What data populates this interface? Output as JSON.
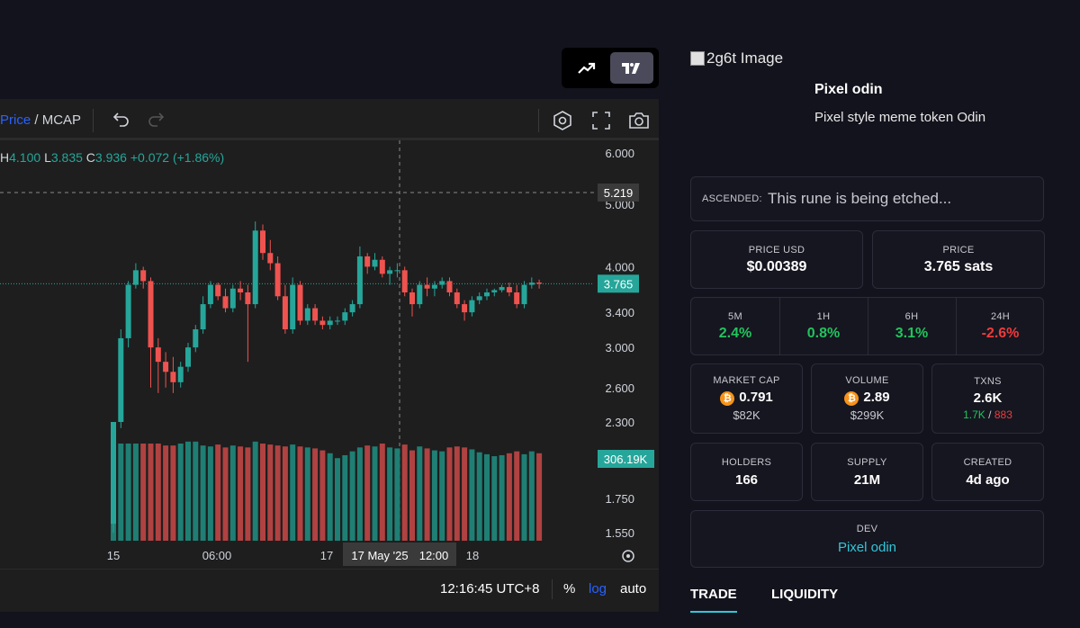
{
  "chart_toolbar": {
    "price_label": "Price",
    "separator": " / ",
    "mcap_label": "MCAP"
  },
  "ohlc": {
    "h_key": "H",
    "h_val": "4.100",
    "l_key": "L",
    "l_val": "3.835",
    "c_key": "C",
    "c_val": "3.936",
    "change": "+0.072 (+1.86%)"
  },
  "chart_data": {
    "type": "candlestick",
    "price_ticks": [
      "6.000",
      "5.000",
      "4.000",
      "3.400",
      "3.000",
      "2.600",
      "2.300",
      "1.750",
      "1.550"
    ],
    "price_tick_values": [
      6.0,
      5.0,
      4.0,
      3.4,
      3.0,
      2.6,
      2.3,
      1.75,
      1.55
    ],
    "x_ticks": [
      "15",
      "06:00",
      "17",
      "12:00",
      "18"
    ],
    "crosshair_date_label": "17 May '25",
    "crosshair_time_label": "12:00",
    "crosshair_price": "5.219",
    "last_price": "3.765",
    "last_volume": "306.19K",
    "ohlc": [
      [
        1.6,
        2.3,
        1.55,
        2.3
      ],
      [
        2.3,
        3.2,
        2.25,
        3.1
      ],
      [
        3.1,
        3.8,
        3.0,
        3.75
      ],
      [
        3.75,
        4.05,
        3.7,
        3.95
      ],
      [
        3.95,
        4.0,
        3.7,
        3.8
      ],
      [
        3.8,
        3.85,
        2.6,
        3.0
      ],
      [
        3.0,
        3.1,
        2.55,
        2.85
      ],
      [
        2.85,
        2.95,
        2.6,
        2.75
      ],
      [
        2.75,
        2.9,
        2.55,
        2.65
      ],
      [
        2.65,
        2.85,
        2.6,
        2.8
      ],
      [
        2.8,
        3.05,
        2.75,
        3.0
      ],
      [
        3.0,
        3.25,
        2.95,
        3.2
      ],
      [
        3.2,
        3.6,
        3.15,
        3.5
      ],
      [
        3.5,
        3.8,
        3.45,
        3.75
      ],
      [
        3.75,
        3.78,
        3.55,
        3.6
      ],
      [
        3.6,
        3.7,
        3.4,
        3.45
      ],
      [
        3.45,
        3.75,
        3.4,
        3.7
      ],
      [
        3.7,
        3.8,
        3.55,
        3.65
      ],
      [
        3.65,
        3.75,
        2.85,
        3.5
      ],
      [
        3.5,
        4.7,
        3.45,
        4.55
      ],
      [
        4.55,
        4.65,
        4.1,
        4.2
      ],
      [
        4.2,
        4.4,
        3.95,
        4.05
      ],
      [
        4.05,
        4.15,
        3.55,
        3.6
      ],
      [
        3.6,
        3.75,
        3.15,
        3.2
      ],
      [
        3.2,
        3.85,
        3.15,
        3.75
      ],
      [
        3.75,
        3.8,
        3.25,
        3.3
      ],
      [
        3.3,
        3.5,
        3.25,
        3.45
      ],
      [
        3.45,
        3.5,
        3.25,
        3.3
      ],
      [
        3.3,
        3.35,
        3.2,
        3.25
      ],
      [
        3.25,
        3.35,
        3.2,
        3.3
      ],
      [
        3.3,
        3.35,
        3.25,
        3.3
      ],
      [
        3.3,
        3.45,
        3.25,
        3.4
      ],
      [
        3.4,
        3.55,
        3.35,
        3.5
      ],
      [
        3.5,
        4.3,
        3.45,
        4.15
      ],
      [
        4.15,
        4.2,
        3.9,
        4.0
      ],
      [
        4.0,
        4.2,
        3.95,
        4.1
      ],
      [
        4.1,
        4.15,
        3.85,
        3.9
      ],
      [
        3.9,
        4.0,
        3.75,
        3.95
      ],
      [
        3.95,
        4.05,
        3.85,
        3.95
      ],
      [
        3.95,
        4.0,
        3.6,
        3.65
      ],
      [
        3.65,
        3.7,
        3.35,
        3.5
      ],
      [
        3.5,
        3.8,
        3.45,
        3.75
      ],
      [
        3.75,
        3.85,
        3.6,
        3.7
      ],
      [
        3.7,
        3.8,
        3.6,
        3.75
      ],
      [
        3.75,
        3.85,
        3.7,
        3.8
      ],
      [
        3.8,
        3.85,
        3.6,
        3.65
      ],
      [
        3.65,
        3.7,
        3.45,
        3.5
      ],
      [
        3.5,
        3.55,
        3.3,
        3.4
      ],
      [
        3.4,
        3.6,
        3.35,
        3.55
      ],
      [
        3.55,
        3.65,
        3.5,
        3.6
      ],
      [
        3.6,
        3.7,
        3.55,
        3.65
      ],
      [
        3.65,
        3.7,
        3.6,
        3.68
      ],
      [
        3.68,
        3.75,
        3.65,
        3.72
      ],
      [
        3.72,
        3.78,
        3.6,
        3.65
      ],
      [
        3.65,
        3.75,
        3.45,
        3.5
      ],
      [
        3.5,
        3.8,
        3.45,
        3.75
      ],
      [
        3.75,
        3.85,
        3.7,
        3.78
      ],
      [
        3.78,
        3.82,
        3.7,
        3.765
      ]
    ],
    "volume_note": "relative volume per candle, same order",
    "volume": [
      0.9,
      1.0,
      1.0,
      1.0,
      1.0,
      1.0,
      1.0,
      0.98,
      0.98,
      1.0,
      1.02,
      1.02,
      0.98,
      0.97,
      0.99,
      0.96,
      0.98,
      0.97,
      0.96,
      1.02,
      1.0,
      0.99,
      0.98,
      0.97,
      0.99,
      0.97,
      0.96,
      0.95,
      0.93,
      0.9,
      0.85,
      0.88,
      0.92,
      0.96,
      0.98,
      0.97,
      1.0,
      0.96,
      0.95,
      0.99,
      0.93,
      0.97,
      0.95,
      0.93,
      0.92,
      0.96,
      0.97,
      0.96,
      0.94,
      0.91,
      0.89,
      0.87,
      0.88,
      0.9,
      0.92,
      0.89,
      0.92,
      0.9
    ]
  },
  "time_bar": {
    "clock": "12:16:45 UTC+8",
    "percent": "%",
    "log": "log",
    "auto": "auto"
  },
  "token": {
    "image_alt": "2g6t Image",
    "name": "Pixel odin",
    "description": "Pixel style meme token Odin"
  },
  "ascended": {
    "label": "ASCENDED:",
    "value": "This rune is being etched..."
  },
  "prices": {
    "usd_label": "PRICE USD",
    "usd_value": "$0.00389",
    "sats_label": "PRICE",
    "sats_value": "3.765 sats"
  },
  "changes": [
    {
      "label": "5M",
      "value": "2.4%",
      "color": "#21c45d"
    },
    {
      "label": "1H",
      "value": "0.8%",
      "color": "#21c45d"
    },
    {
      "label": "6H",
      "value": "3.1%",
      "color": "#21c45d"
    },
    {
      "label": "24H",
      "value": "-2.6%",
      "color": "#ef3b3b"
    }
  ],
  "market": {
    "mcap_label": "MARKET CAP",
    "mcap_value": "0.791",
    "mcap_usd": "$82K",
    "volume_label": "VOLUME",
    "volume_value": "2.89",
    "volume_usd": "$299K",
    "txns_label": "TXNS",
    "txns_value": "2.6K",
    "txns_buys": "1.7K",
    "txns_sep": "/",
    "txns_sells": "883"
  },
  "stats": {
    "holders_label": "HOLDERS",
    "holders_value": "166",
    "supply_label": "SUPPLY",
    "supply_value": "21M",
    "created_label": "CREATED",
    "created_value": "4d ago"
  },
  "dev": {
    "label": "DEV",
    "value": "Pixel odin"
  },
  "tabs": {
    "trade": "TRADE",
    "liquidity": "LIQUIDITY"
  },
  "colors": {
    "up": "#26a69a",
    "down": "#ef5350",
    "accent": "#30c7d9"
  }
}
